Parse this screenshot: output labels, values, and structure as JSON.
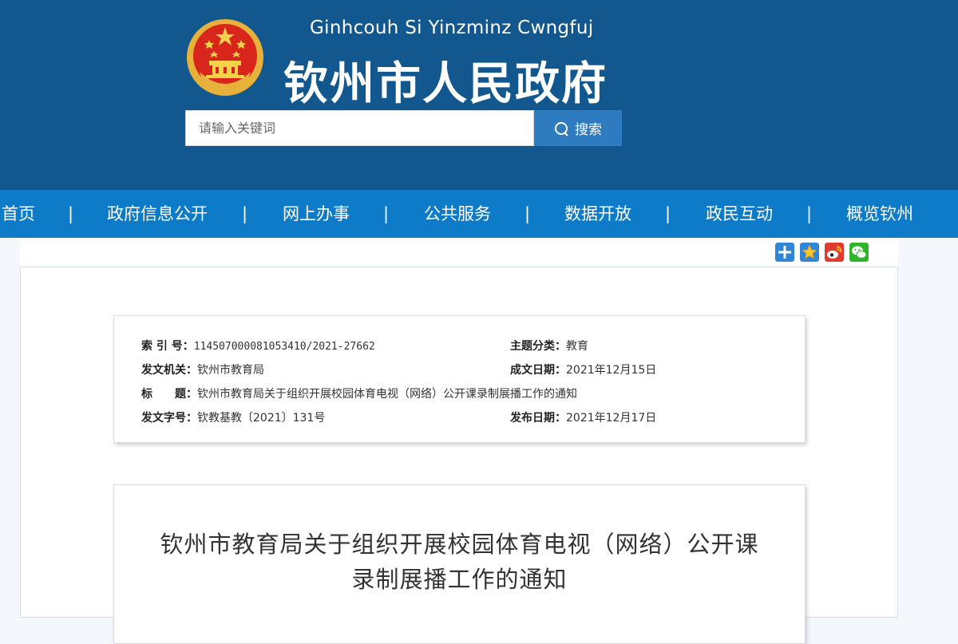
{
  "header": {
    "pinyin_title": "Ginhcouh Si Yinzminz Cwngfuj",
    "site_title": "钦州市人民政府",
    "emblem_icon": "national-emblem-icon",
    "background_color": "#12588f"
  },
  "search": {
    "placeholder": "请输入关键词",
    "button_label": "搜索",
    "icon": "search-icon"
  },
  "nav": {
    "background_color": "#0e7bc9",
    "items": [
      {
        "label": "首页"
      },
      {
        "label": "政府信息公开"
      },
      {
        "label": "网上办事"
      },
      {
        "label": "公共服务"
      },
      {
        "label": "数据开放"
      },
      {
        "label": "政民互动"
      },
      {
        "label": "概览钦州"
      }
    ],
    "separator": "|"
  },
  "share": {
    "icons": [
      "share-plus-icon",
      "favorite-star-icon",
      "weibo-icon",
      "wechat-icon"
    ]
  },
  "meta": {
    "index_no": {
      "label": "索 引 号：",
      "value": "114507000081053410/2021-27662"
    },
    "category": {
      "label": "主题分类：",
      "value": "教育"
    },
    "issuer": {
      "label": "发文机关：",
      "value": "钦州市教育局"
    },
    "date_written": {
      "label": "成文日期：",
      "value": "2021年12月15日"
    },
    "title": {
      "label": "标　　题：",
      "value": "钦州市教育局关于组织开展校园体育电视（网络）公开课录制展播工作的通知"
    },
    "doc_no": {
      "label": "发文字号：",
      "value": "钦教基教〔2021〕131号"
    },
    "date_published": {
      "label": "发布日期：",
      "value": "2021年12月17日"
    }
  },
  "document": {
    "title_line1": "钦州市教育局关于组织开展校园体育电视（网络）公开课",
    "title_line2": "录制展播工作的通知"
  }
}
